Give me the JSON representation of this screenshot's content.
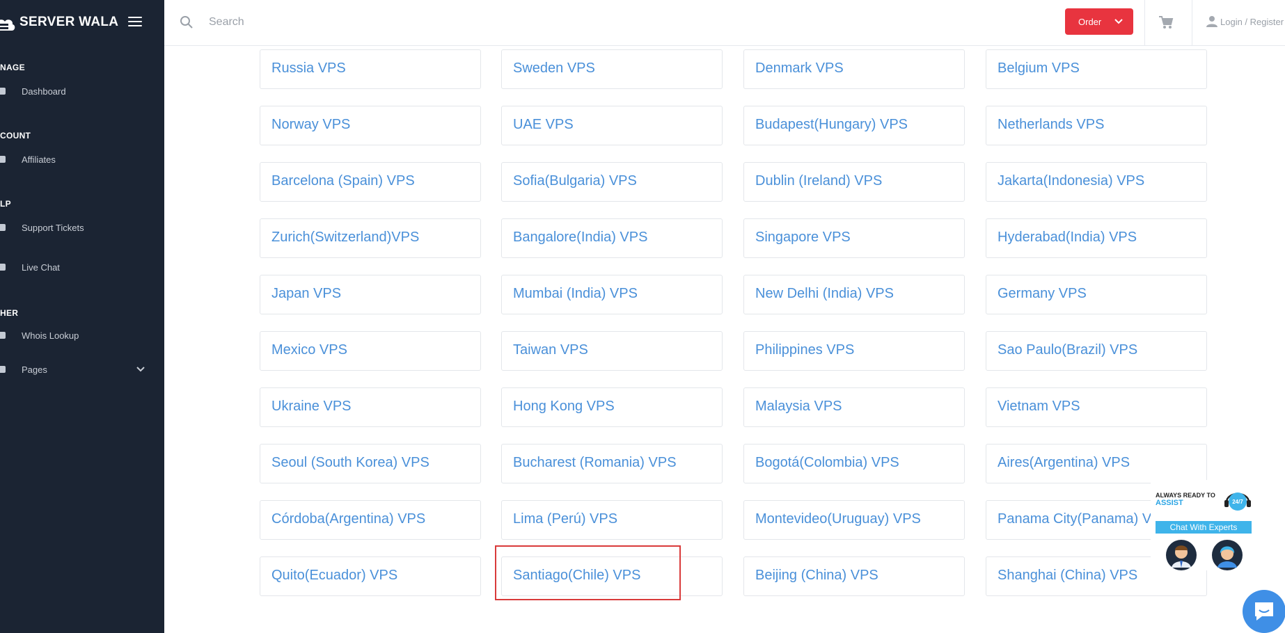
{
  "brand": {
    "name": "SERVER WALA"
  },
  "sidebar": {
    "sections": [
      {
        "title": "NAGE",
        "items": [
          {
            "label": "Dashboard",
            "icon": "home-icon"
          }
        ]
      },
      {
        "title": "COUNT",
        "items": [
          {
            "label": "Affiliates",
            "icon": "user-plus-icon"
          }
        ]
      },
      {
        "title": "LP",
        "items": [
          {
            "label": "Support Tickets",
            "icon": "ticket-icon"
          },
          {
            "label": "Live Chat",
            "icon": "chat-icon"
          }
        ]
      },
      {
        "title": "HER",
        "items": [
          {
            "label": "Whois Lookup",
            "icon": "login-icon"
          },
          {
            "label": "Pages",
            "icon": "login-icon"
          }
        ]
      }
    ]
  },
  "header": {
    "search_placeholder": "Search",
    "order_label": "Order",
    "login_label": "Login / Register",
    "accent": "#e8343f"
  },
  "vps_links": [
    "Russia VPS",
    "Sweden VPS",
    "Denmark VPS",
    "Belgium VPS",
    "Norway VPS",
    "UAE VPS",
    "Budapest(Hungary) VPS",
    "Netherlands VPS",
    "Barcelona (Spain) VPS",
    "Sofia(Bulgaria) VPS",
    "Dublin (Ireland) VPS",
    "Jakarta(Indonesia) VPS",
    "Zurich(Switzerland)VPS",
    "Bangalore(India) VPS",
    "Singapore VPS",
    "Hyderabad(India) VPS",
    "Japan VPS",
    "Mumbai (India) VPS",
    "New Delhi (India) VPS",
    "Germany VPS",
    "Mexico VPS",
    "Taiwan VPS",
    "Philippines VPS",
    "Sao Paulo(Brazil) VPS",
    "Ukraine VPS",
    "Hong Kong VPS",
    "Malaysia VPS",
    "Vietnam VPS",
    "Seoul (South Korea) VPS",
    "Bucharest (Romania) VPS",
    "Bogotá(Colombia) VPS",
    "Aires(Argentina) VPS",
    "Córdoba(Argentina) VPS",
    "Lima (Perú) VPS",
    "Montevideo(Uruguay) VPS",
    "Panama City(Panama) VPS",
    "Quito(Ecuador) VPS",
    "Santiago(Chile) VPS",
    "Beijing (China) VPS",
    "Shanghai (China) VPS"
  ],
  "chat_widget": {
    "line1": "ALWAYS READY TO",
    "line2": "ASSIST",
    "badge": "24/7",
    "cta": "Chat With Experts"
  },
  "colors": {
    "sidebar_bg": "#1b2433",
    "link": "#4a90d9",
    "highlight": "#d93a3a"
  }
}
